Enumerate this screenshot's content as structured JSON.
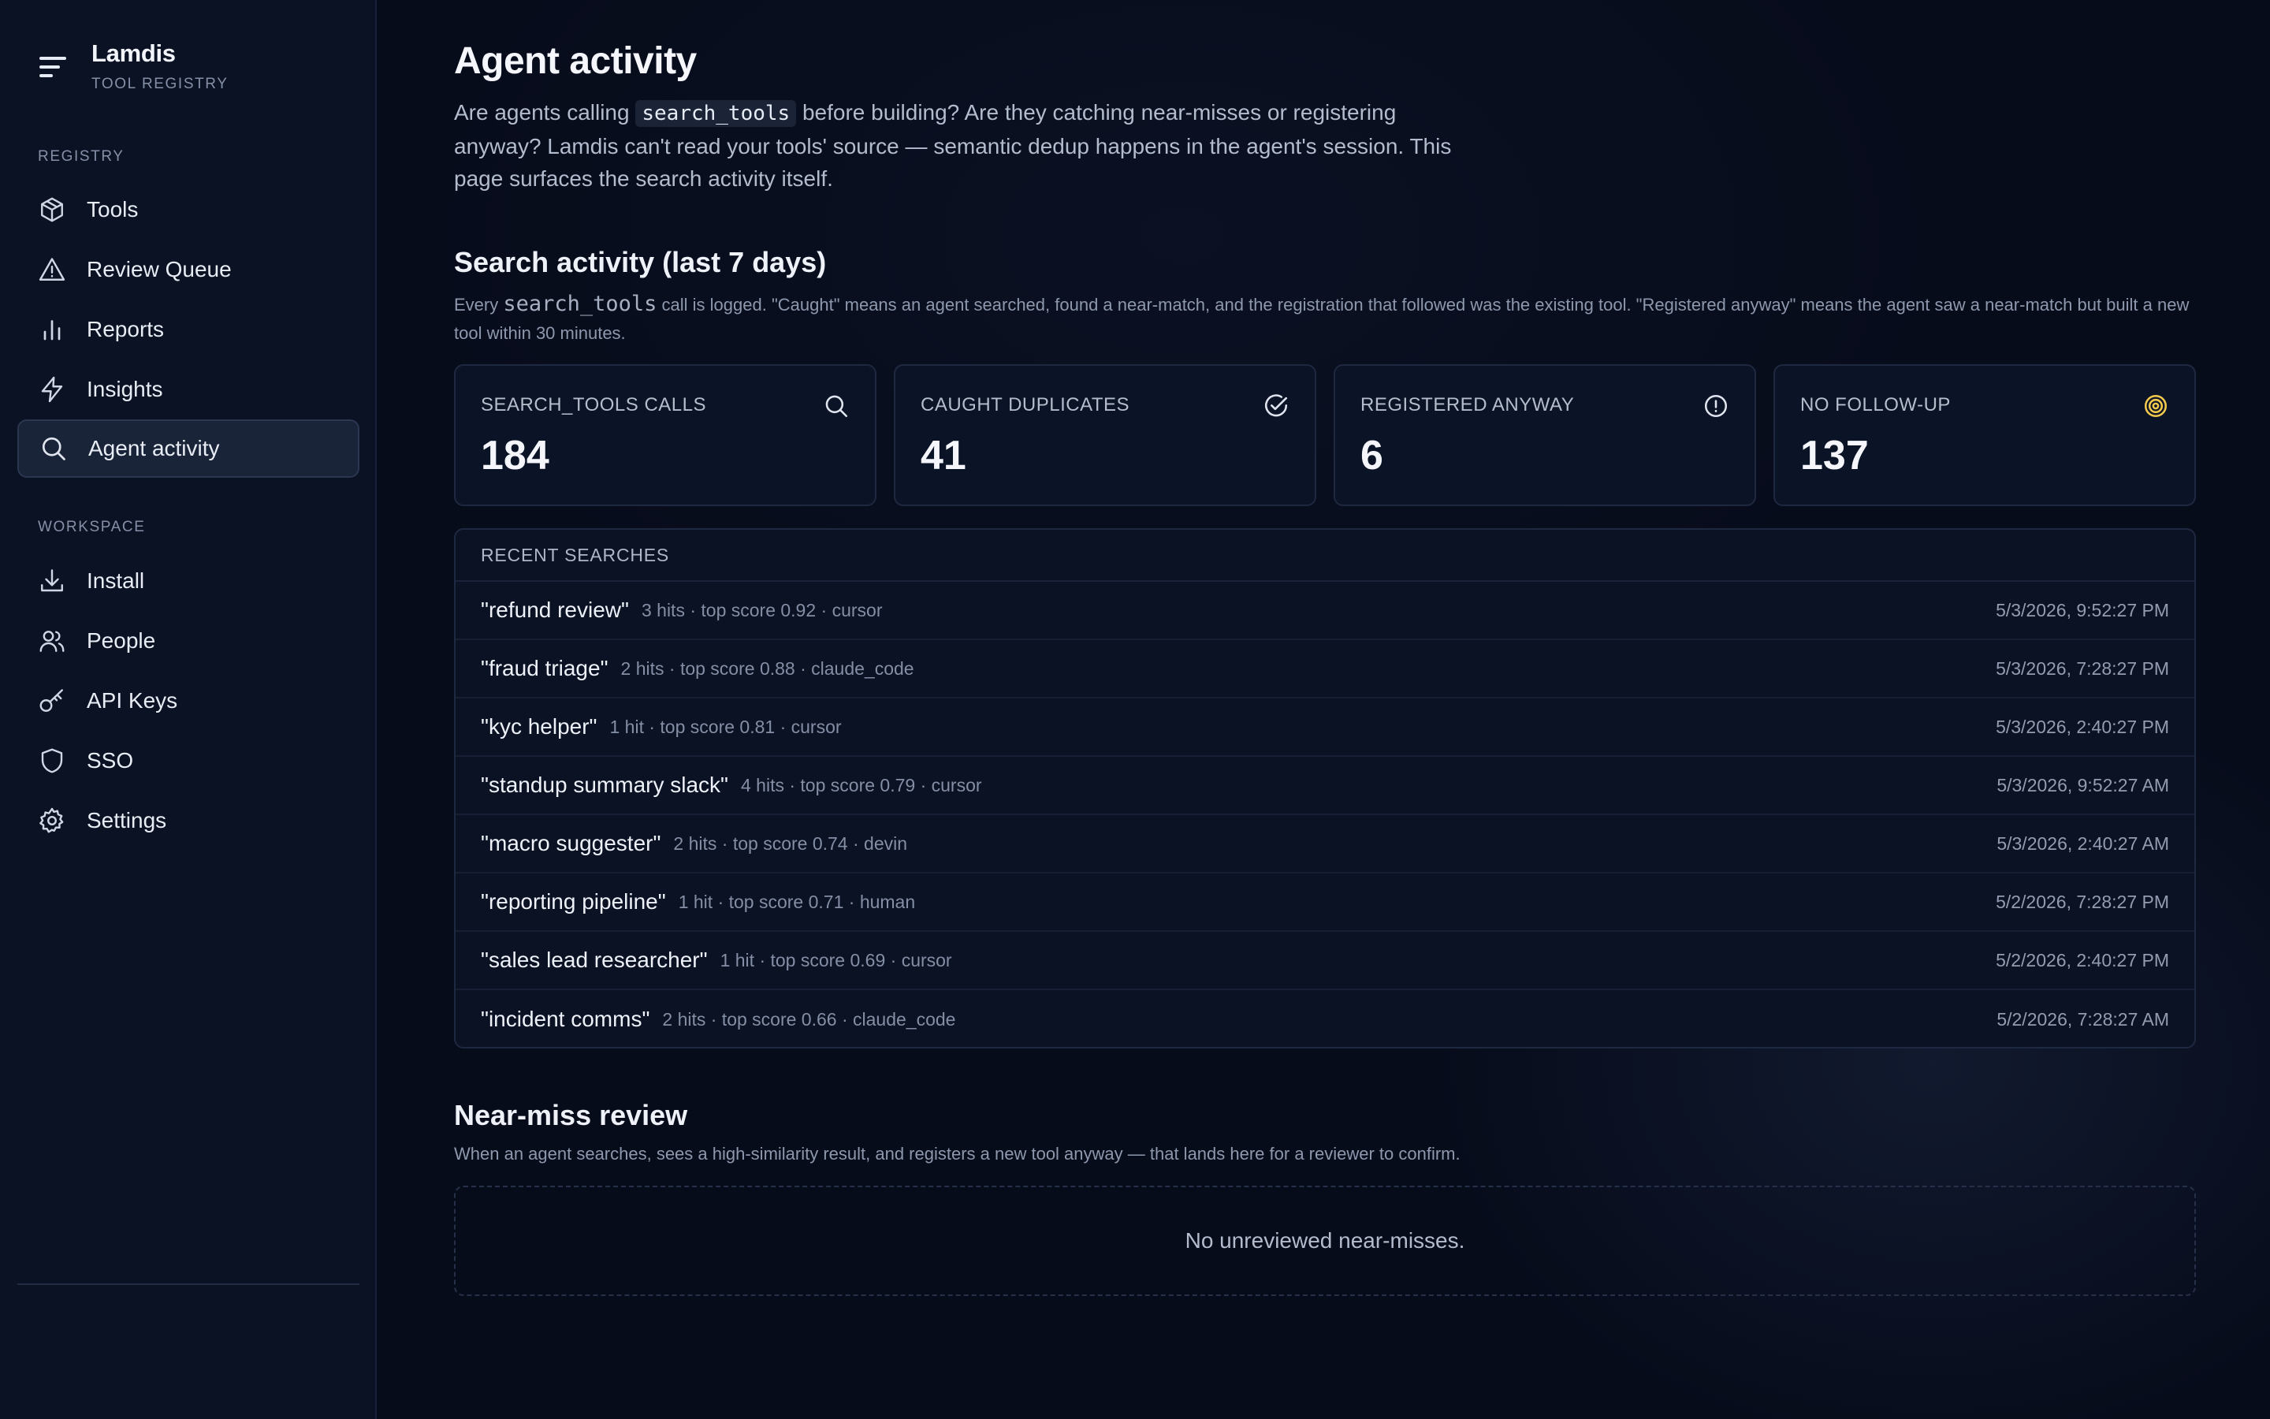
{
  "app": {
    "name": "Lamdis",
    "subtitle": "TOOL REGISTRY"
  },
  "sidebar": {
    "sections": [
      {
        "label": "REGISTRY",
        "items": [
          {
            "label": "Tools",
            "icon": "box-icon",
            "active": false
          },
          {
            "label": "Review Queue",
            "icon": "warning-triangle-icon",
            "active": false
          },
          {
            "label": "Reports",
            "icon": "bar-chart-icon",
            "active": false
          },
          {
            "label": "Insights",
            "icon": "lightning-icon",
            "active": false
          },
          {
            "label": "Agent activity",
            "icon": "search-icon",
            "active": true
          }
        ]
      },
      {
        "label": "WORKSPACE",
        "items": [
          {
            "label": "Install",
            "icon": "download-icon",
            "active": false
          },
          {
            "label": "People",
            "icon": "people-icon",
            "active": false
          },
          {
            "label": "API Keys",
            "icon": "key-icon",
            "active": false
          },
          {
            "label": "SSO",
            "icon": "shield-icon",
            "active": false
          },
          {
            "label": "Settings",
            "icon": "gear-icon",
            "active": false
          }
        ]
      }
    ]
  },
  "page": {
    "title": "Agent activity",
    "intro_before": "Are agents calling ",
    "intro_code": "search_tools",
    "intro_after": " before building? Are they catching near-misses or registering anyway? Lamdis can't read your tools' source — semantic dedup happens in the agent's session. This page surfaces the search activity itself."
  },
  "search_activity": {
    "title": "Search activity (last 7 days)",
    "desc_before": "Every ",
    "desc_code": "search_tools",
    "desc_after": " call is logged. \"Caught\" means an agent searched, found a near-match, and the registration that followed was the existing tool. \"Registered anyway\" means the agent saw a near-match but built a new tool within 30 minutes.",
    "stats": [
      {
        "label": "SEARCH_TOOLS CALLS",
        "value": "184",
        "icon": "search-icon",
        "icon_color": "#dfe4ee"
      },
      {
        "label": "CAUGHT DUPLICATES",
        "value": "41",
        "icon": "check-circle-icon",
        "icon_color": "#dfe4ee"
      },
      {
        "label": "REGISTERED ANYWAY",
        "value": "6",
        "icon": "alert-circle-icon",
        "icon_color": "#dfe4ee"
      },
      {
        "label": "NO FOLLOW-UP",
        "value": "137",
        "icon": "target-icon",
        "icon_color": "#f2c94c"
      }
    ]
  },
  "recent_searches": {
    "header": "RECENT SEARCHES",
    "rows": [
      {
        "query": "\"refund review\"",
        "meta": "3 hits · top score 0.92 · cursor",
        "time": "5/3/2026, 9:52:27 PM"
      },
      {
        "query": "\"fraud triage\"",
        "meta": "2 hits · top score 0.88 · claude_code",
        "time": "5/3/2026, 7:28:27 PM"
      },
      {
        "query": "\"kyc helper\"",
        "meta": "1 hit · top score 0.81 · cursor",
        "time": "5/3/2026, 2:40:27 PM"
      },
      {
        "query": "\"standup summary slack\"",
        "meta": "4 hits · top score 0.79 · cursor",
        "time": "5/3/2026, 9:52:27 AM"
      },
      {
        "query": "\"macro suggester\"",
        "meta": "2 hits · top score 0.74 · devin",
        "time": "5/3/2026, 2:40:27 AM"
      },
      {
        "query": "\"reporting pipeline\"",
        "meta": "1 hit · top score 0.71 · human",
        "time": "5/2/2026, 7:28:27 PM"
      },
      {
        "query": "\"sales lead researcher\"",
        "meta": "1 hit · top score 0.69 · cursor",
        "time": "5/2/2026, 2:40:27 PM"
      },
      {
        "query": "\"incident comms\"",
        "meta": "2 hits · top score 0.66 · claude_code",
        "time": "5/2/2026, 7:28:27 AM"
      }
    ]
  },
  "near_miss": {
    "title": "Near-miss review",
    "desc": "When an agent searches, sees a high-similarity result, and registers a new tool anyway — that lands here for a reviewer to confirm.",
    "empty": "No unreviewed near-misses."
  }
}
